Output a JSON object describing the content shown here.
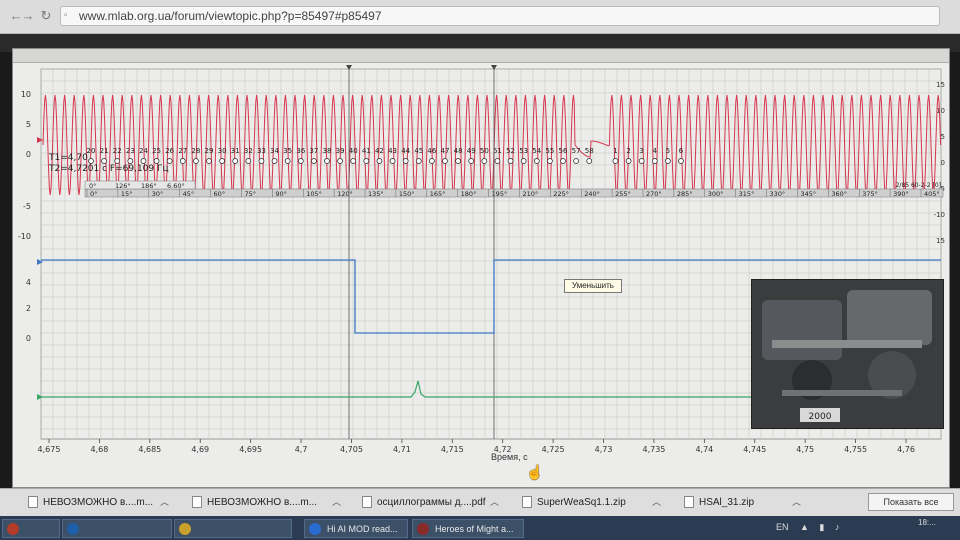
{
  "browser": {
    "url": "www.mlab.org.ua/forum/viewtopic.php?p=85497#p85497",
    "back_icon": "back-arrow-icon",
    "forward_icon": "forward-arrow-icon",
    "reload_icon": "reload-icon"
  },
  "scope": {
    "t1_label": "T1=4,70",
    "t2_label": "T2=4,7201 c  F=69,109 Гц",
    "popup_label": "Уменьшить",
    "time_axis_label": "Время, с",
    "x_ticks": [
      "4,675",
      "4,68",
      "4,685",
      "4,69",
      "4,695",
      "4,7",
      "4,705",
      "4,71",
      "4,715",
      "4,72",
      "4,725",
      "4,73",
      "4,735",
      "4,74",
      "4,745",
      "4,75",
      "4,755",
      "4,76"
    ],
    "y_ticks_upper": [
      "10",
      "5",
      "0",
      "-5",
      "-10"
    ],
    "y_ticks_upper_right": [
      "15",
      "10",
      "5",
      "0",
      "-5",
      "-10",
      "15"
    ],
    "y_ticks_lower": [
      "4",
      "2",
      "0"
    ],
    "tooth_numbers": [
      "20",
      "21",
      "22",
      "23",
      "24",
      "25",
      "26",
      "27",
      "28",
      "29",
      "30",
      "31",
      "32",
      "33",
      "34",
      "35",
      "36",
      "37",
      "38",
      "39",
      "40",
      "41",
      "42",
      "43",
      "44",
      "45",
      "46",
      "47",
      "48",
      "49",
      "50",
      "51",
      "52",
      "53",
      "54",
      "55",
      "56",
      "57",
      "58",
      "",
      "1",
      "2",
      "3",
      "4",
      "5",
      "6"
    ],
    "angle_scale_prefix": [
      "0°",
      "126°",
      "186°",
      "6.60°"
    ],
    "angle_labels": [
      "0°",
      "15°",
      "30°",
      "45°",
      "60°",
      "75°",
      "90°",
      "105°",
      "120°",
      "135°",
      "150°",
      "165°",
      "180°",
      "195°",
      "210°",
      "225°",
      "240°",
      "255°",
      "270°",
      "285°",
      "300°",
      "315°",
      "330°",
      "345°",
      "360°",
      "375°",
      "390°",
      "405°"
    ],
    "angle_corner": "2/85  60-2-2 [0]",
    "colors": {
      "crank_signal": "#d7354e",
      "cam_signal": "#3e78c6",
      "third_signal": "#3aa66a",
      "grid": "#b9c7b6",
      "background": "#ececeb"
    },
    "engine_photo_caption": "2000"
  },
  "downloads": [
    {
      "name": "НЕВОЗМОЖНО в....m...",
      "icon": "file-icon"
    },
    {
      "name": "НЕВОЗМОЖНО в....m...",
      "icon": "file-icon"
    },
    {
      "name": "осциллограммы д....pdf",
      "icon": "pdf-icon"
    },
    {
      "name": "SuperWeaSq1.1.zip",
      "icon": "zip-icon"
    },
    {
      "name": "HSAl_31.zip",
      "icon": "zip-icon"
    }
  ],
  "downloads_show_all": "Показать все",
  "taskbar": {
    "items": [
      {
        "label": "",
        "color": "#b23b2a"
      },
      {
        "label": "",
        "color": "#1d5fa8"
      },
      {
        "label": "",
        "color": "#c8a02b"
      },
      {
        "label": "Hi AI MOD read...",
        "color": "#2a6bd0"
      },
      {
        "label": "Heroes of Might a...",
        "color": "#8a2a2a"
      }
    ],
    "lang": "EN",
    "clock": "18:..."
  }
}
